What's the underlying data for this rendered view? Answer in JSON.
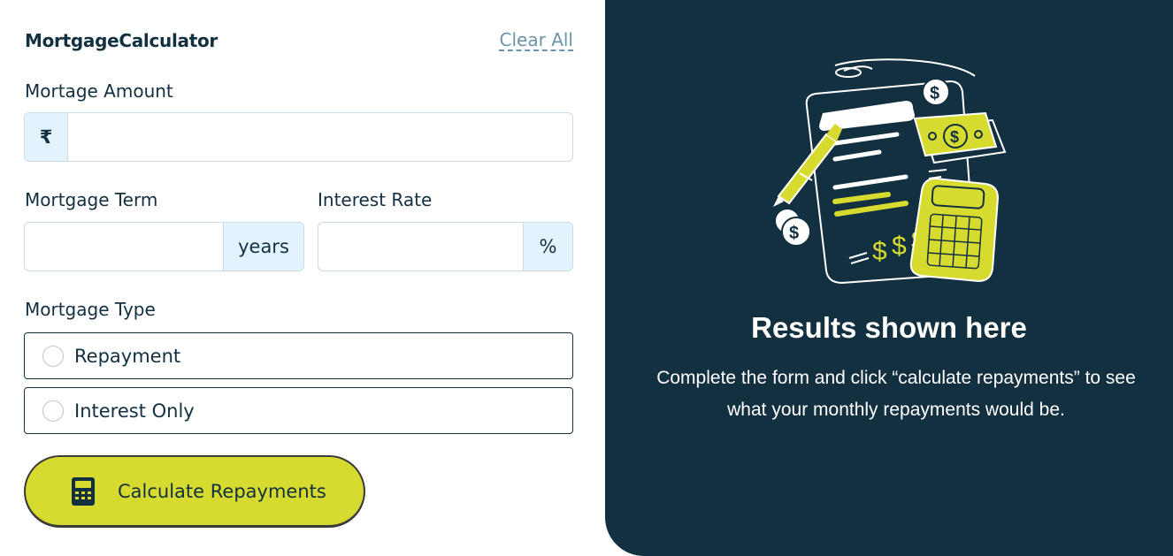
{
  "header": {
    "title": "MortgageCalculator",
    "clear_label": "Clear All"
  },
  "amount": {
    "label": "Mortage Amount",
    "prefix": "₹",
    "value": ""
  },
  "term": {
    "label": "Mortgage Term",
    "suffix": "years",
    "value": ""
  },
  "rate": {
    "label": "Interest Rate",
    "suffix": "%",
    "value": ""
  },
  "mortgage_type": {
    "label": "Mortgage Type",
    "options": [
      {
        "label": "Repayment",
        "selected": false
      },
      {
        "label": "Interest Only",
        "selected": false
      }
    ]
  },
  "calculate": {
    "label": "Calculate Repayments",
    "icon": "calculator-icon"
  },
  "results": {
    "title": "Results shown here",
    "description": "Complete the form and click “calculate repayments” to see what your monthly repayments would be.",
    "illustration": "empty-results-illustration"
  },
  "colors": {
    "dark": "#133041",
    "accent": "#d8db2f",
    "addon_bg": "#e3f3fd",
    "muted": "#6b94a8"
  }
}
